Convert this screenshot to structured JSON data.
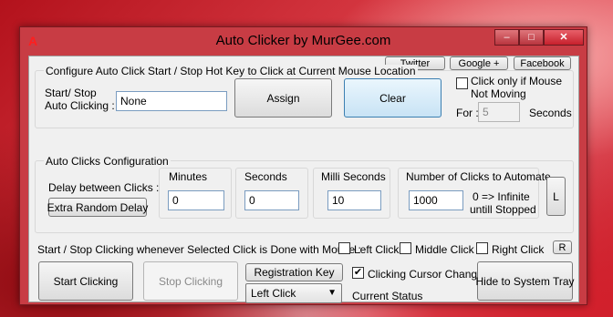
{
  "window": {
    "title": "Auto Clicker by MurGee.com",
    "app_icon_letter": "A",
    "minimize": "–",
    "maximize": "□",
    "close": "✕"
  },
  "social": {
    "twitter": "Twitter",
    "google": "Google +",
    "facebook": "Facebook"
  },
  "hotkey": {
    "heading": "Configure Auto Click Start / Stop Hot Key to Click at Current Mouse Location",
    "label_line1": "Start/ Stop",
    "label_line2": "Auto Clicking :",
    "value": "None",
    "assign": "Assign",
    "clear": "Clear",
    "click_only_line1": "Click only if Mouse",
    "click_only_line2": "Not Moving",
    "for_label": "For :",
    "for_value": "5",
    "seconds_label": "Seconds"
  },
  "config": {
    "heading": "Auto Clicks Configuration",
    "delay_label": "Delay between Clicks :",
    "extra_random": "Extra Random Delay",
    "minutes_label": "Minutes",
    "minutes_value": "0",
    "seconds_label": "Seconds",
    "seconds_value": "0",
    "milli_label": "Milli Seconds",
    "milli_value": "10",
    "num_clicks_label": "Number of Clicks to Automate",
    "num_clicks_value": "1000",
    "infinite_line1": "0 => Infinite",
    "infinite_line2": "untill Stopped",
    "l_button": "L"
  },
  "mouse": {
    "label": "Start / Stop Clicking whenever Selected Click is Done with Mouse :",
    "left_click": "Left Click",
    "middle_click": "Middle Click",
    "right_click": "Right Click",
    "r_button": "R"
  },
  "bottom": {
    "start": "Start Clicking",
    "stop": "Stop Clicking",
    "registration": "Registration Key",
    "click_type": "Left Click",
    "cursor_change": "Clicking Cursor Change",
    "cursor_change_checked": true,
    "current_status": "Current Status",
    "hide": "Hide to System Tray"
  }
}
